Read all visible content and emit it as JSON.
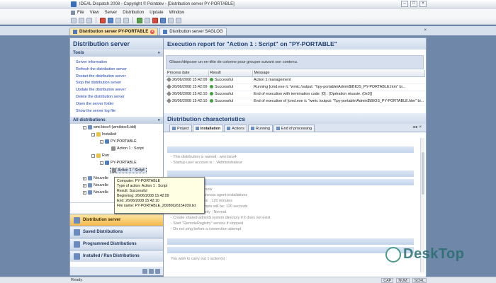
{
  "window": {
    "title": "IDEAL Dispatch 2008 - Copyright © Pointdev - [Distribution server PY-PORTABLE]"
  },
  "menu": [
    "File",
    "View",
    "Server",
    "Distribution",
    "Update",
    "Window"
  ],
  "doc_tabs": [
    {
      "label": "Distribution server PY-PORTABLE",
      "active": true
    },
    {
      "label": "Distribution server SAGLOG",
      "active": false
    }
  ],
  "left": {
    "header": "Distribution server",
    "tools_title": "Tools",
    "tools": [
      "Server information",
      "Refresh the distribution server",
      "Restart the distribution server",
      "Stop the distribution server",
      "Update the distribution server",
      "Delete the distribution server",
      "Open the server folder",
      "Show the server log file"
    ],
    "all_title": "All distributions",
    "tree": {
      "root": "wmi.bios4 (wmibios5.idd)",
      "installed": "Installed",
      "pc1": "PY-PORTABLE",
      "action1": "Action 1 : Script",
      "run": "Run",
      "pc2": "PY-PORTABLE",
      "action2": "Action 1 : Script",
      "n1": "Nouvelle",
      "n2": "Nouvelle",
      "n3": "Nouvelle"
    },
    "nav": [
      "Distribution server",
      "Saved Distributions",
      "Programmed Distributions",
      "Installed / Run Distributions"
    ]
  },
  "tooltip": [
    "Computer: PY-PORTABLE",
    "Type of action: Action 1 : Script",
    "Result: Successful",
    "Beginning: 26/06/2008 15:42:09",
    "End: 26/06/2008 15:42:10",
    "File name: PY-PORTABLE_20080626154209.txt"
  ],
  "report": {
    "title": "Execution report for \"Action 1 : Script\" on \"PY-PORTABLE\"",
    "group_hint": "Glisser/déposer un en-tête de colonne pour grouper suivant son contenu.",
    "columns": [
      "Process date",
      "Result",
      "Message"
    ],
    "rows": [
      [
        "26/06/2008 15:42:09",
        "Successful",
        "Action 1 management"
      ],
      [
        "26/06/2008 15:42:09",
        "Successful",
        "Running [cmd.exe /c \"wmic /output: \"\\\\py-portable\\Admin$\\BIOS_PY-PORTABLE.htm\" bi..."
      ],
      [
        "26/06/2008 15:42:10",
        "Successful",
        "End of execution with termination code: [0] : [Opération réussie. (0x0)]"
      ],
      [
        "26/06/2008 15:42:10",
        "Successful",
        "End of execution of [cmd.exe /c \"wmic /output: \"\\\\py-portable\\Admin$\\BIOS_PY-PORTABLE.htm\" bi..."
      ]
    ]
  },
  "characteristics": {
    "title": "Distribution characteristics",
    "tabs": [
      "Project",
      "Installation",
      "Actions",
      "Running",
      "End of processing"
    ],
    "lines_a": [
      "- This distribution is named : wmi.bios4",
      "- Startup user account is : .\\Administrateur"
    ],
    "lines_b": [
      "... maximum agents now",
      "... number of simultaneous agent installations",
      "... attempt to install for : 120 minutes",
      "... between two attempts will be: 120 seconds",
      "- Set installation priority : Normal",
      "- Create shared admin$ system directory if it does not exist",
      "- Start \"RemoteRegistry\" service if stopped",
      "- Do not ping before a connection attempt"
    ],
    "lines_c": [
      "You wish to carry out 1 action(s) :"
    ]
  },
  "status": {
    "text": "Ready",
    "keys": [
      "CAP",
      "NUM",
      "SCRL"
    ]
  },
  "watermark": "DeskTop"
}
